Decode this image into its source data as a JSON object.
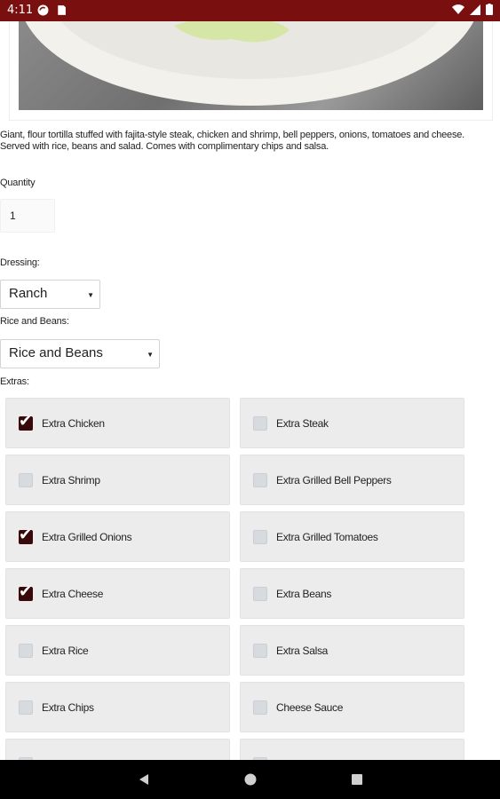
{
  "status_bar": {
    "time": "4:11",
    "left_icons": [
      "sync-icon",
      "sd-card-icon"
    ],
    "right_icons": [
      "wifi-icon",
      "signal-icon",
      "battery-icon"
    ]
  },
  "description": "Giant, flour tortilla stuffed with fajita-style steak, chicken and shrimp, bell peppers, onions, tomatoes and cheese. Served with rice, beans and salad. Comes with complimentary chips and salsa.",
  "quantity": {
    "label": "Quantity",
    "value": "1"
  },
  "dressing": {
    "label": "Dressing:",
    "selected": "Ranch"
  },
  "rice_and_beans": {
    "label": "Rice and Beans:",
    "selected": "Rice and Beans"
  },
  "extras": {
    "label": "Extras:",
    "items": [
      {
        "label": "Extra Chicken",
        "checked": true
      },
      {
        "label": "Extra Steak",
        "checked": false
      },
      {
        "label": "Extra Shrimp",
        "checked": false
      },
      {
        "label": "Extra Grilled Bell Peppers",
        "checked": false
      },
      {
        "label": "Extra Grilled Onions",
        "checked": true
      },
      {
        "label": "Extra Grilled Tomatoes",
        "checked": false
      },
      {
        "label": "Extra Cheese",
        "checked": true
      },
      {
        "label": "Extra Beans",
        "checked": false
      },
      {
        "label": "Extra Rice",
        "checked": false
      },
      {
        "label": "Extra Salsa",
        "checked": false
      },
      {
        "label": "Extra Chips",
        "checked": false
      },
      {
        "label": "Cheese Sauce",
        "checked": false
      }
    ]
  },
  "colors": {
    "status_bar": "#7a0f0f",
    "checkbox_checked": "#3a0a0a",
    "option_bg": "#ececec"
  },
  "nav_bar": {
    "icons": [
      "back-icon",
      "home-icon",
      "recents-icon"
    ]
  }
}
